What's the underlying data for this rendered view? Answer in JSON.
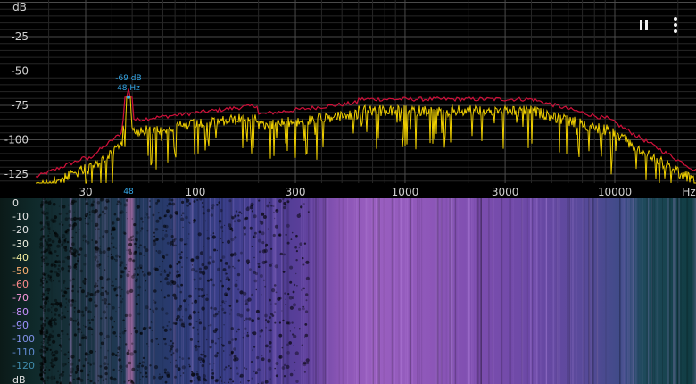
{
  "spectrum": {
    "db_unit": "dB",
    "y_ticks": [
      {
        "label": "-25",
        "value": -25
      },
      {
        "label": "-50",
        "value": -50
      },
      {
        "label": "-75",
        "value": -75
      },
      {
        "label": "-100",
        "value": -100
      },
      {
        "label": "-125",
        "value": -125
      }
    ],
    "x_ticks": [
      {
        "label": "30",
        "value": 30
      },
      {
        "label": "100",
        "value": 100
      },
      {
        "label": "300",
        "value": 300
      },
      {
        "label": "1000",
        "value": 1000
      },
      {
        "label": "3000",
        "value": 3000
      },
      {
        "label": "10000",
        "value": 10000
      }
    ],
    "x_unit": "Hz",
    "peak": {
      "db_label": "-69 dB",
      "hz_label": "48 Hz",
      "marker_label": "48",
      "freq": 48,
      "db": -69
    },
    "colors": {
      "live": "#f0d000",
      "peak_hold": "#d0103a",
      "peak_marker": "#36a8e8",
      "grid": "#3a3a3a"
    }
  },
  "controls": {
    "pause": {
      "icon": "pause-icon"
    },
    "menu": {
      "icon": "more-vertical-icon"
    }
  },
  "spectrogram": {
    "db_unit": "dB",
    "scale": [
      {
        "label": "0",
        "color": "#e0e0e0"
      },
      {
        "label": "-10",
        "color": "#e6e6e6"
      },
      {
        "label": "-20",
        "color": "#e6e6e6"
      },
      {
        "label": "-30",
        "color": "#f0f0e0"
      },
      {
        "label": "-40",
        "color": "#f6f0a0"
      },
      {
        "label": "-50",
        "color": "#ffb070"
      },
      {
        "label": "-60",
        "color": "#ff8a8a"
      },
      {
        "label": "-70",
        "color": "#ff9adf"
      },
      {
        "label": "-80",
        "color": "#c890ff"
      },
      {
        "label": "-90",
        "color": "#9c90ff"
      },
      {
        "label": "-100",
        "color": "#7f90e6"
      },
      {
        "label": "-110",
        "color": "#5f8ad0"
      },
      {
        "label": "-120",
        "color": "#3f8aaa"
      }
    ]
  }
}
